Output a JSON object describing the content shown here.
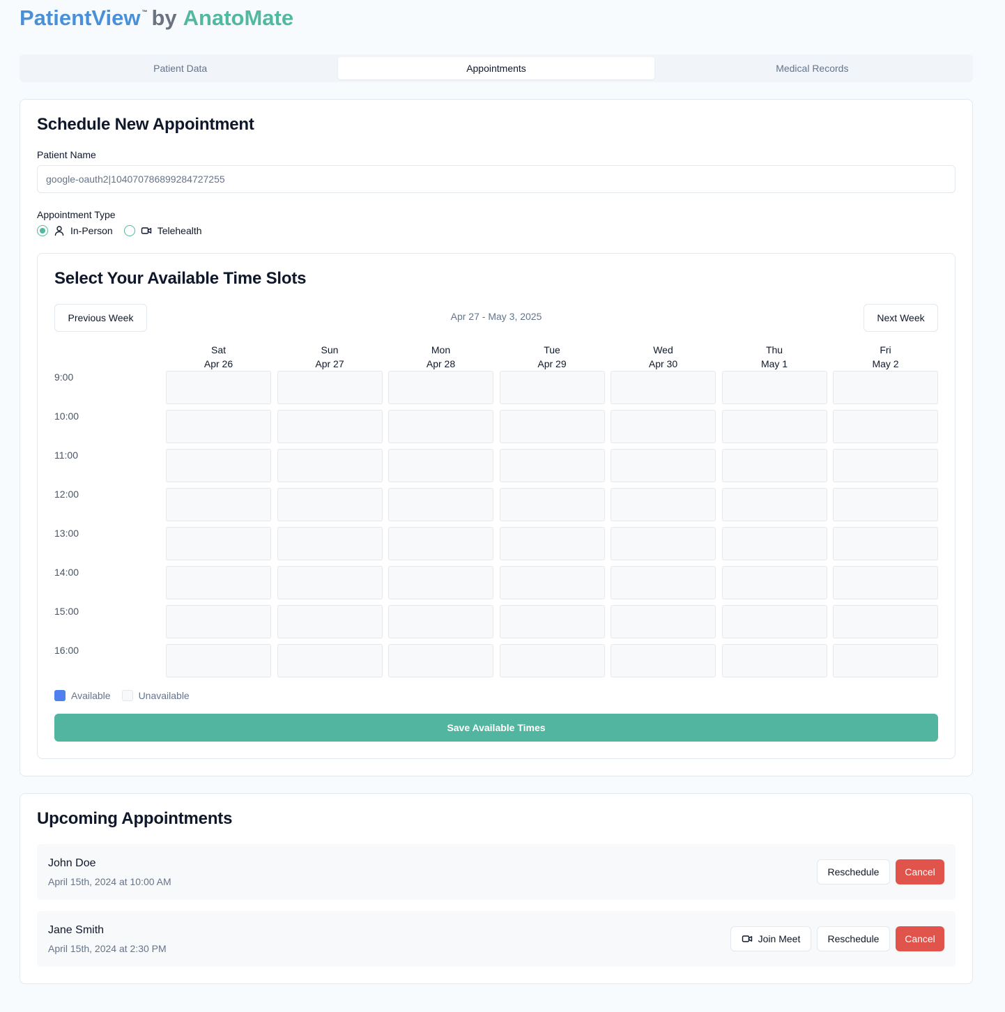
{
  "brand": {
    "name": "PatientView",
    "tm": "™",
    "by": "by",
    "company": "AnatoMate"
  },
  "tabs": [
    {
      "label": "Patient Data"
    },
    {
      "label": "Appointments",
      "active": true
    },
    {
      "label": "Medical Records"
    }
  ],
  "schedule": {
    "title": "Schedule New Appointment",
    "patient_label": "Patient Name",
    "patient_value": "google-oauth2|104070786899284727255",
    "type_label": "Appointment Type",
    "types": [
      {
        "label": "In-Person",
        "icon": "person-icon",
        "checked": true
      },
      {
        "label": "Telehealth",
        "icon": "video-icon",
        "checked": false
      }
    ]
  },
  "slots": {
    "title": "Select Your Available Time Slots",
    "prev_label": "Previous Week",
    "next_label": "Next Week",
    "week_range": "Apr 27 - May 3, 2025",
    "days": [
      {
        "dow": "Sat",
        "date": "Apr 26"
      },
      {
        "dow": "Sun",
        "date": "Apr 27"
      },
      {
        "dow": "Mon",
        "date": "Apr 28"
      },
      {
        "dow": "Tue",
        "date": "Apr 29"
      },
      {
        "dow": "Wed",
        "date": "Apr 30"
      },
      {
        "dow": "Thu",
        "date": "May 1"
      },
      {
        "dow": "Fri",
        "date": "May 2"
      }
    ],
    "times": [
      "9:00",
      "10:00",
      "11:00",
      "12:00",
      "13:00",
      "14:00",
      "15:00",
      "16:00"
    ],
    "legend": {
      "available": "Available",
      "unavailable": "Unavailable"
    },
    "save_label": "Save Available Times"
  },
  "upcoming": {
    "title": "Upcoming Appointments",
    "items": [
      {
        "name": "John Doe",
        "time": "April 15th, 2024 at 10:00 AM",
        "join": false
      },
      {
        "name": "Jane Smith",
        "time": "April 15th, 2024 at 2:30 PM",
        "join": true
      }
    ],
    "join_label": "Join Meet",
    "reschedule_label": "Reschedule",
    "cancel_label": "Cancel"
  },
  "colors": {
    "brand_blue": "#4a90d9",
    "brand_green": "#52b89f",
    "available": "#4f80ee",
    "unavailable": "#f8f9fb",
    "save_button": "#52b5a0",
    "cancel_button": "#e0544c"
  }
}
